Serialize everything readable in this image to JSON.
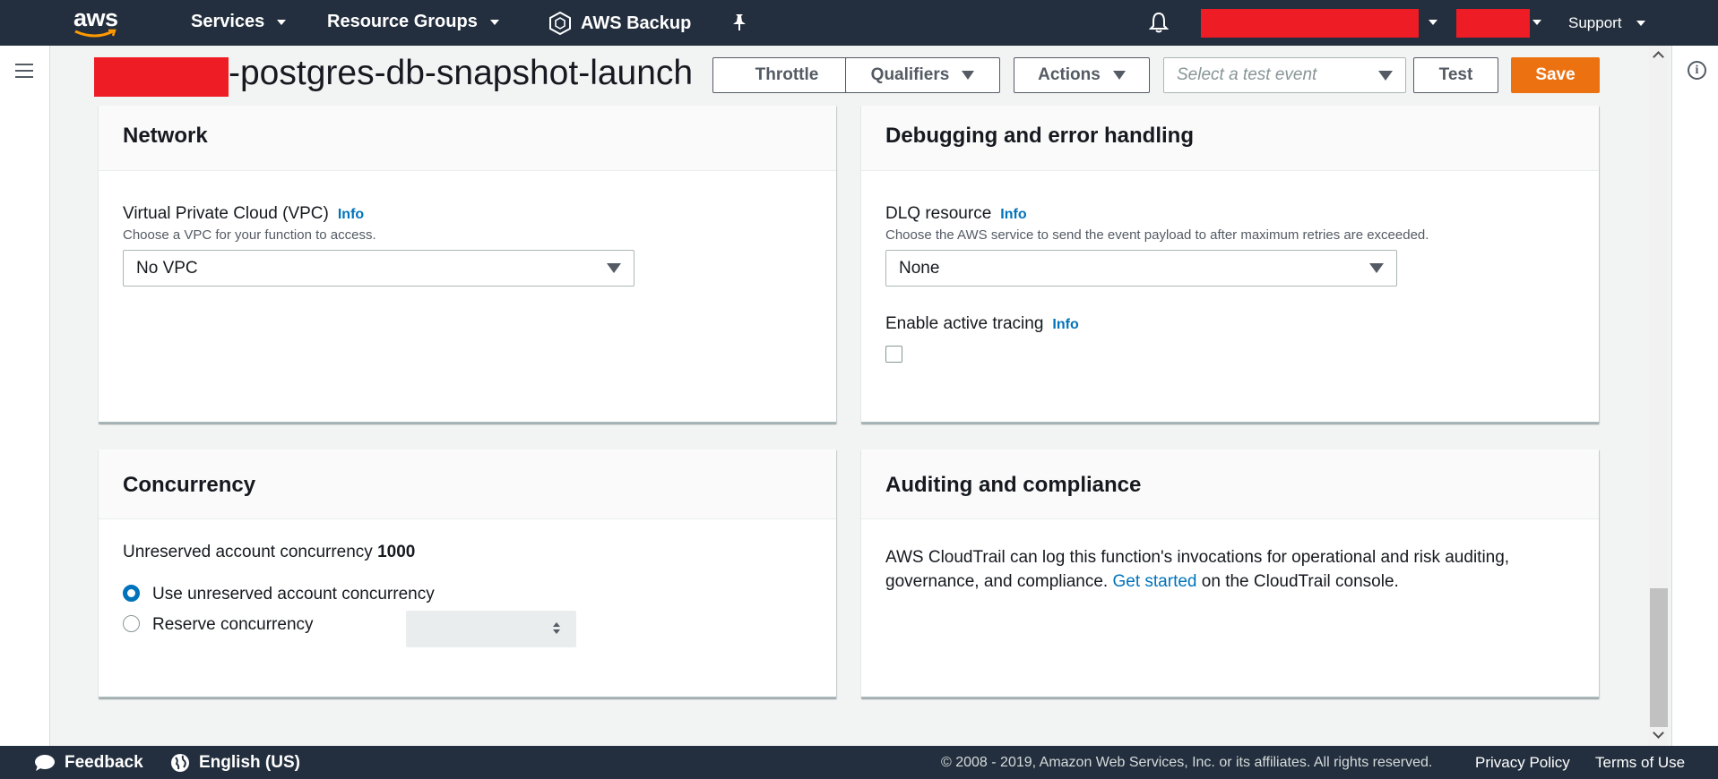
{
  "topnav": {
    "logo_text": "aws",
    "services": "Services",
    "resource_groups": "Resource Groups",
    "aws_backup": "AWS Backup",
    "support": "Support"
  },
  "header": {
    "function_name_suffix": "-postgres-db-snapshot-launch",
    "throttle": "Throttle",
    "qualifiers": "Qualifiers",
    "actions": "Actions",
    "test_event_placeholder": "Select a test event",
    "test": "Test",
    "save": "Save"
  },
  "network": {
    "title": "Network",
    "vpc_label": "Virtual Private Cloud (VPC)",
    "info": "Info",
    "vpc_desc": "Choose a VPC for your function to access.",
    "vpc_value": "No VPC"
  },
  "debugging": {
    "title": "Debugging and error handling",
    "dlq_label": "DLQ resource",
    "info": "Info",
    "dlq_desc": "Choose the AWS service to send the event payload to after maximum retries are exceeded.",
    "dlq_value": "None",
    "tracing_label": "Enable active tracing",
    "tracing_info": "Info",
    "tracing_enabled": false
  },
  "concurrency": {
    "title": "Concurrency",
    "unreserved_label": "Unreserved account concurrency",
    "unreserved_value": "1000",
    "option_unreserved": "Use unreserved account concurrency",
    "option_reserve": "Reserve concurrency",
    "selected_option": "unreserved"
  },
  "auditing": {
    "title": "Auditing and compliance",
    "text_before": "AWS CloudTrail can log this function's invocations for operational and risk auditing, governance, and compliance.",
    "link": "Get started",
    "text_after": "on the CloudTrail console."
  },
  "footer": {
    "feedback": "Feedback",
    "language": "English (US)",
    "copyright": "© 2008 - 2019, Amazon Web Services, Inc. or its affiliates. All rights reserved.",
    "privacy": "Privacy Policy",
    "terms": "Terms of Use"
  },
  "colors": {
    "nav_bg": "#232f3e",
    "accent_orange": "#ec7211",
    "link_blue": "#0073bb",
    "redaction": "#ee1c25"
  }
}
